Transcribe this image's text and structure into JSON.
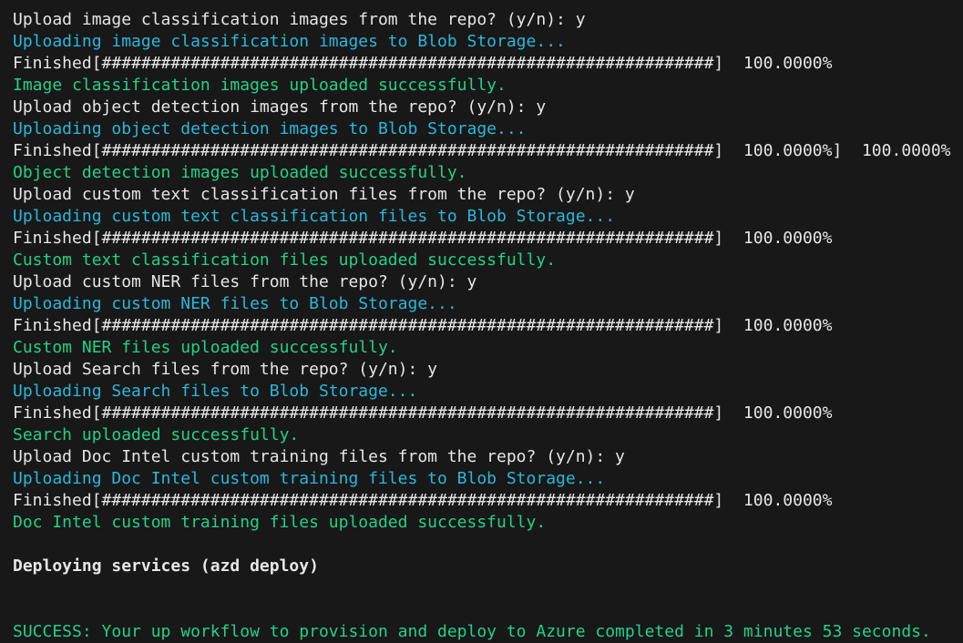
{
  "terminal": {
    "lines": [
      {
        "text": "Upload image classification images from the repo? (y/n): y",
        "color": "white"
      },
      {
        "text": "Uploading image classification images to Blob Storage...",
        "color": "cyan"
      },
      {
        "text": "Finished[##############################################################]  100.0000%",
        "color": "white"
      },
      {
        "text": "Image classification images uploaded successfully.",
        "color": "green"
      },
      {
        "text": "Upload object detection images from the repo? (y/n): y",
        "color": "white"
      },
      {
        "text": "Uploading object detection images to Blob Storage...",
        "color": "cyan"
      },
      {
        "text": "Finished[##############################################################]  100.0000%]  100.0000%",
        "color": "white"
      },
      {
        "text": "Object detection images uploaded successfully.",
        "color": "green"
      },
      {
        "text": "Upload custom text classification files from the repo? (y/n): y",
        "color": "white"
      },
      {
        "text": "Uploading custom text classification files to Blob Storage...",
        "color": "cyan"
      },
      {
        "text": "Finished[##############################################################]  100.0000%",
        "color": "white"
      },
      {
        "text": "Custom text classification files uploaded successfully.",
        "color": "green"
      },
      {
        "text": "Upload custom NER files from the repo? (y/n): y",
        "color": "white"
      },
      {
        "text": "Uploading custom NER files to Blob Storage...",
        "color": "cyan"
      },
      {
        "text": "Finished[##############################################################]  100.0000%",
        "color": "white"
      },
      {
        "text": "Custom NER files uploaded successfully.",
        "color": "green"
      },
      {
        "text": "Upload Search files from the repo? (y/n): y",
        "color": "white"
      },
      {
        "text": "Uploading Search files to Blob Storage...",
        "color": "cyan"
      },
      {
        "text": "Finished[##############################################################]  100.0000%",
        "color": "white"
      },
      {
        "text": "Search uploaded successfully.",
        "color": "green"
      },
      {
        "text": "Upload Doc Intel custom training files from the repo? (y/n): y",
        "color": "white"
      },
      {
        "text": "Uploading Doc Intel custom training files to Blob Storage...",
        "color": "cyan"
      },
      {
        "text": "Finished[##############################################################]  100.0000%",
        "color": "white"
      },
      {
        "text": "Doc Intel custom training files uploaded successfully.",
        "color": "green"
      },
      {
        "text": "",
        "color": "white"
      },
      {
        "text": "Deploying services (azd deploy)",
        "color": "bold"
      },
      {
        "text": "",
        "color": "white"
      },
      {
        "text": "",
        "color": "white"
      },
      {
        "text": "SUCCESS: Your up workflow to provision and deploy to Azure completed in 3 minutes 53 seconds.",
        "color": "green"
      }
    ]
  },
  "colors": {
    "background": "#181818",
    "white": "#e6e6e6",
    "cyan": "#29b8db",
    "green": "#23d18b"
  }
}
